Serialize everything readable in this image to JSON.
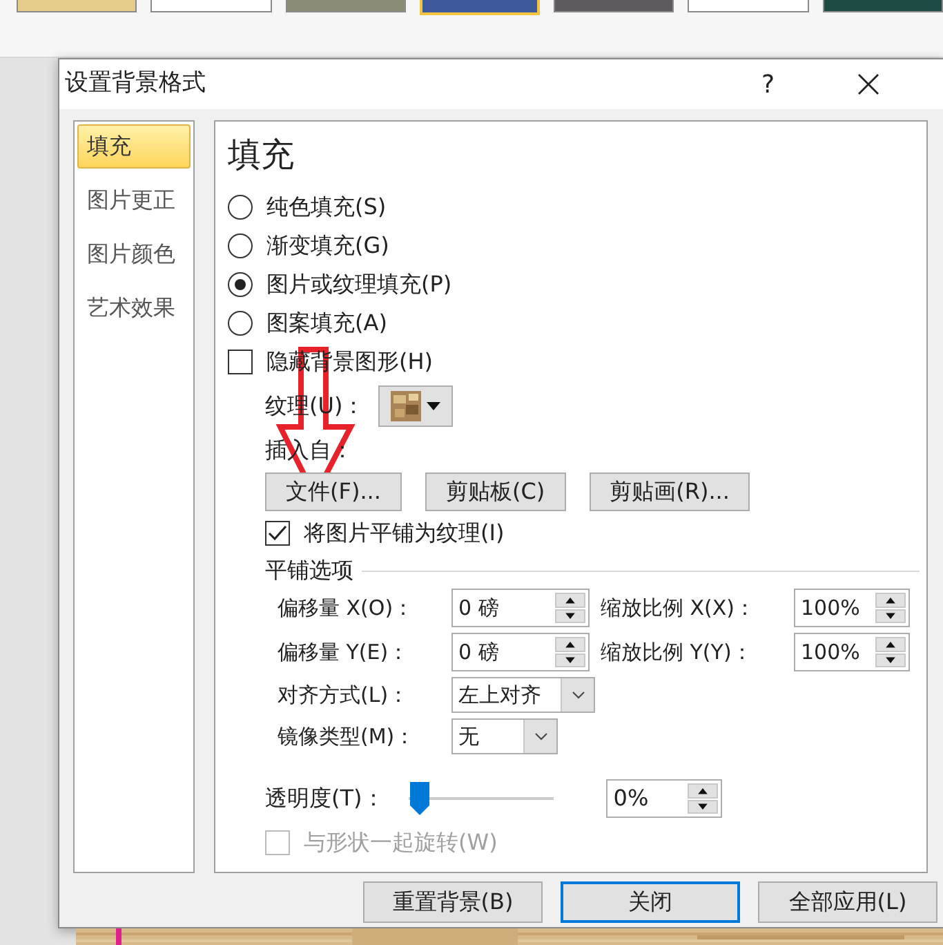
{
  "themes": [
    {
      "color": "#e6cc8a",
      "selected": false
    },
    {
      "color": "#ffffff",
      "selected": false
    },
    {
      "color": "#8a8c78",
      "selected": false
    },
    {
      "color": "#3e5a9a",
      "selected": true
    },
    {
      "color": "#5e5b5e",
      "selected": false
    },
    {
      "color": "#ffffff",
      "selected": false
    },
    {
      "color": "#1e4a44",
      "selected": false
    }
  ],
  "window": {
    "title": "设置背景格式",
    "help": "?"
  },
  "sidebar": {
    "items": [
      {
        "label": "填充",
        "selected": true
      },
      {
        "label": "图片更正",
        "selected": false
      },
      {
        "label": "图片颜色",
        "selected": false
      },
      {
        "label": "艺术效果",
        "selected": false
      }
    ]
  },
  "panel": {
    "heading": "填充",
    "fill_options": [
      {
        "label": "纯色填充(S)",
        "selected": false
      },
      {
        "label": "渐变填充(G)",
        "selected": false
      },
      {
        "label": "图片或纹理填充(P)",
        "selected": true
      },
      {
        "label": "图案填充(A)",
        "selected": false
      }
    ],
    "hide_background_graphics": {
      "label": "隐藏背景图形(H)",
      "checked": false
    },
    "texture": {
      "label": "纹理(U)："
    },
    "insert_from": {
      "label": "插入自：",
      "buttons": [
        "文件(F)...",
        "剪贴板(C)",
        "剪贴画(R)..."
      ]
    },
    "tile_as_texture": {
      "label": "将图片平铺为纹理(I)",
      "checked": true
    },
    "tiling_options": {
      "title": "平铺选项",
      "fields": [
        {
          "kind": "spin",
          "label": "偏移量 X(O)：",
          "value": "0 磅"
        },
        {
          "kind": "spin",
          "label": "缩放比例 X(X)：",
          "value": "100%"
        },
        {
          "kind": "spin",
          "label": "偏移量 Y(E)：",
          "value": "0 磅"
        },
        {
          "kind": "spin",
          "label": "缩放比例 Y(Y)：",
          "value": "100%"
        },
        {
          "kind": "dropdown",
          "label": "对齐方式(L)：",
          "value": "左上对齐"
        },
        {
          "kind": "dropdown",
          "label": "镜像类型(M)：",
          "value": "无"
        }
      ]
    },
    "transparency": {
      "label": "透明度(T)：",
      "level": 0,
      "value": "0%"
    },
    "rotate_with_shape": {
      "label": "与形状一起旋转(W)",
      "checked": false,
      "disabled": true
    }
  },
  "footer": {
    "buttons": [
      {
        "label": "重置背景(B)",
        "default": false
      },
      {
        "label": "关闭",
        "default": true
      },
      {
        "label": "全部应用(L)",
        "default": false
      }
    ]
  }
}
